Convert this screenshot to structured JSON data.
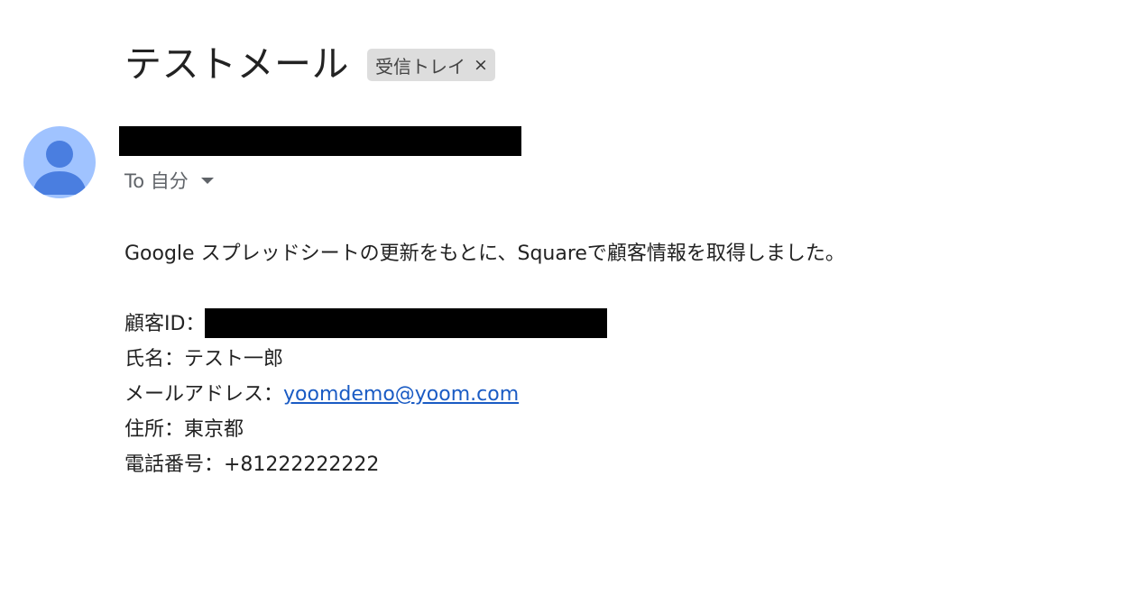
{
  "email": {
    "subject": "テストメール",
    "label_chip": {
      "label": "受信トレイ",
      "close_glyph": "×"
    },
    "recipient_text": "To 自分",
    "body": {
      "intro": "Google スプレッドシートの更新をもとに、Squareで顧客情報を取得しました。",
      "customer_id_label": "顧客ID：",
      "name_line": "氏名：テスト一郎",
      "email_label": "メールアドレス：",
      "email_value": "yoomdemo@yoom.com",
      "address_line": "住所：東京都",
      "phone_line": "電話番号：+81222222222"
    }
  },
  "icons": {
    "avatar": "person-avatar-icon",
    "dropdown": "caret-down-icon",
    "chip_close": "close-icon"
  },
  "colors": {
    "avatar_bg": "#a0c3ff",
    "avatar_fg": "#4a7ee0",
    "chip_bg": "#dddddd",
    "link": "#1a5bc4",
    "redaction": "#000000"
  }
}
